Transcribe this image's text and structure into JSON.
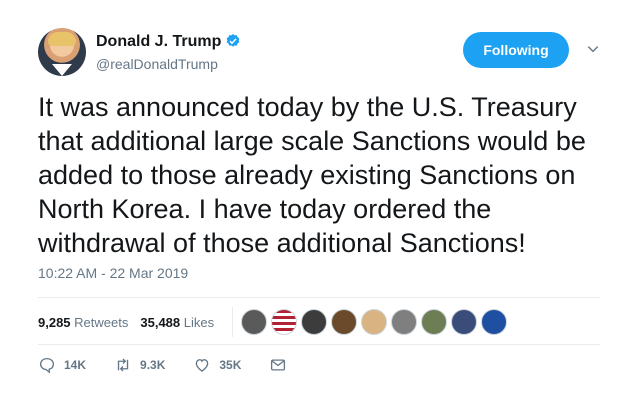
{
  "profile": {
    "display_name": "Donald J. Trump",
    "handle": "@realDonaldTrump",
    "verified": true
  },
  "follow_button": {
    "label": "Following"
  },
  "tweet": {
    "text_lines": [
      "It was announced today by the U.S. Treasury",
      "that additional large scale Sanctions would be",
      "added to those already existing Sanctions on",
      "North Korea. I have today ordered the",
      "withdrawal of those additional Sanctions!"
    ],
    "timestamp": "10:22 AM - 22 Mar 2019"
  },
  "stats": {
    "retweets_count": "9,285",
    "retweets_label": "Retweets",
    "likes_count": "35,488",
    "likes_label": "Likes"
  },
  "actions": {
    "reply_count": "14K",
    "retweet_count": "9.3K",
    "like_count": "35K"
  },
  "colors": {
    "accent": "#1da1f2",
    "muted_text": "#657786",
    "text": "#14171a",
    "divider": "#e6ecf0"
  },
  "icons": [
    "verified-badge-icon",
    "chevron-down-icon",
    "reply-icon",
    "retweet-icon",
    "like-icon",
    "direct-message-icon"
  ]
}
